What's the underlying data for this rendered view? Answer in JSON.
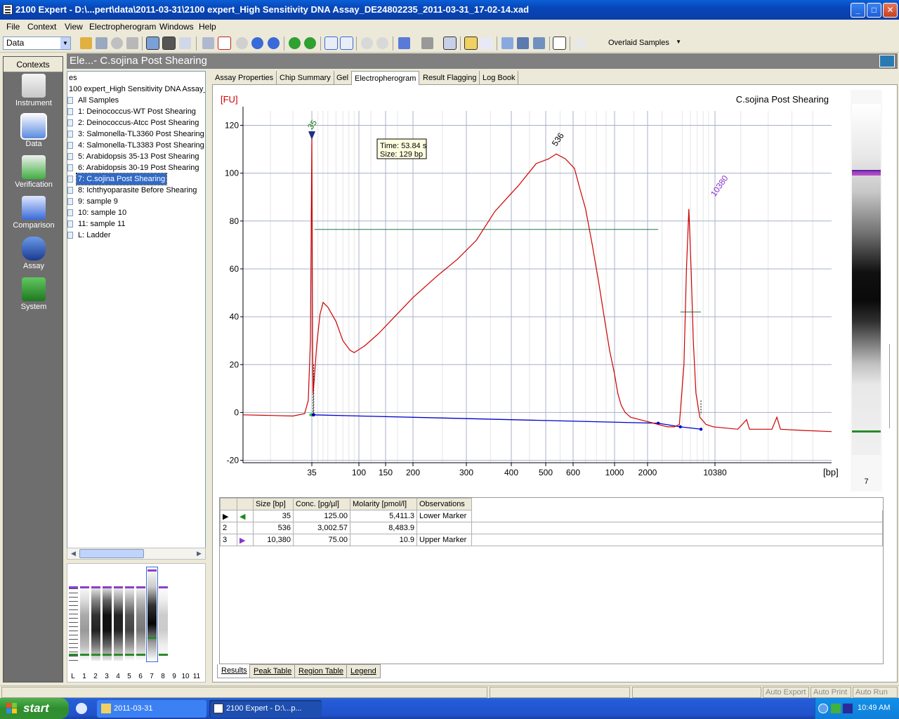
{
  "window": {
    "title": "2100 Expert - D:\\...pert\\data\\2011-03-31\\2100 expert_High Sensitivity DNA Assay_DE24802235_2011-03-31_17-02-14.xad",
    "min": "_",
    "max": "□",
    "close": "✕"
  },
  "menu": [
    "File",
    "Context",
    "View",
    "Electropherogram",
    "Windows",
    "Help"
  ],
  "toolbar": {
    "context_value": "Data",
    "overlay_value": "Overlaid Samples"
  },
  "contexts": {
    "header": "Contexts",
    "items": [
      {
        "label": "Instrument",
        "icon": "instrument-icon"
      },
      {
        "label": "Data",
        "icon": "data-icon"
      },
      {
        "label": "Verification",
        "icon": "verification-icon"
      },
      {
        "label": "Comparison",
        "icon": "comparison-icon"
      },
      {
        "label": "Assay",
        "icon": "assay-icon"
      },
      {
        "label": "System",
        "icon": "system-icon"
      }
    ]
  },
  "tree": {
    "partial": "es",
    "root": "100 expert_High Sensitivity DNA Assay_",
    "items": [
      "All Samples",
      "1: Deinococcus-WT Post Shearing",
      "2: Deinococcus-Atcc Post Shearing",
      "3: Salmonella-TL3360 Post Shearing",
      "4: Salmonella-TL3383 Post Shearing",
      "5: Arabidopsis 35-13 Post Shearing",
      "6: Arabidopsis 30-19 Post Shearing",
      "7: C.sojina Post Shearing",
      "8: Ichthyoparasite Before Shearing",
      "9: sample 9",
      "10: sample 10",
      "11: sample 11",
      "L: Ladder"
    ],
    "selected_index": 7
  },
  "gel_thumbs": {
    "lanes": [
      "L",
      "1",
      "2",
      "3",
      "4",
      "5",
      "6",
      "7",
      "8",
      "9",
      "10",
      "11"
    ],
    "selected": "7"
  },
  "main": {
    "title": "Ele...- C.sojina Post Shearing",
    "tabs": [
      "Assay Properties",
      "Chip Summary",
      "Gel",
      "Electropherogram",
      "Result Flagging",
      "Log Book"
    ]
  },
  "chart_data": {
    "type": "line",
    "title": "C.sojina Post Shearing",
    "ylabel": "[FU]",
    "xlabel": "[bp]",
    "ylim": [
      -20,
      125
    ],
    "yticks": [
      -20,
      0,
      20,
      40,
      60,
      80,
      100,
      120
    ],
    "xtick_labels": [
      "35",
      "100",
      "150",
      "200",
      "300",
      "400",
      "500",
      "600",
      "1000",
      "2000",
      "10380"
    ],
    "grid": true,
    "tooltip": [
      "Time: 53.84 s",
      "Size: 129 bp"
    ],
    "peak_labels": [
      {
        "label": "35",
        "fu": 118,
        "color": "#1a7a1a"
      },
      {
        "label": "536",
        "fu": 111,
        "color": "#000000"
      },
      {
        "label": "10380",
        "fu": 90,
        "color": "#8833cc"
      }
    ],
    "series": [
      {
        "color": "#cc0000",
        "points": [
          [
            20,
            -1
          ],
          [
            24,
            -1.2
          ],
          [
            30,
            -1.5
          ],
          [
            33,
            -0.5
          ],
          [
            34,
            5
          ],
          [
            34.6,
            30
          ],
          [
            35,
            116
          ],
          [
            35.6,
            25
          ],
          [
            36,
            8
          ],
          [
            37,
            14
          ],
          [
            39,
            28
          ],
          [
            42,
            41
          ],
          [
            45,
            46
          ],
          [
            50,
            44
          ],
          [
            60,
            38
          ],
          [
            70,
            30
          ],
          [
            82,
            26
          ],
          [
            90,
            25
          ],
          [
            110,
            28
          ],
          [
            135,
            33
          ],
          [
            165,
            40
          ],
          [
            200,
            48
          ],
          [
            240,
            57
          ],
          [
            280,
            64
          ],
          [
            320,
            72
          ],
          [
            360,
            84
          ],
          [
            420,
            95
          ],
          [
            470,
            104
          ],
          [
            510,
            106
          ],
          [
            536,
            108
          ],
          [
            570,
            106
          ],
          [
            610,
            102
          ],
          [
            650,
            94
          ],
          [
            700,
            85
          ],
          [
            760,
            70
          ],
          [
            820,
            55
          ],
          [
            880,
            40
          ],
          [
            940,
            26
          ],
          [
            1000,
            16
          ],
          [
            1070,
            8
          ],
          [
            1150,
            3
          ],
          [
            1250,
            0
          ],
          [
            1400,
            -2
          ],
          [
            1700,
            -3
          ],
          [
            2100,
            -4
          ],
          [
            2700,
            -5
          ],
          [
            3500,
            -6
          ],
          [
            4200,
            -6
          ],
          [
            4700,
            -5
          ],
          [
            5200,
            20
          ],
          [
            5500,
            60
          ],
          [
            5800,
            85
          ],
          [
            6100,
            60
          ],
          [
            6400,
            30
          ],
          [
            6800,
            8
          ],
          [
            7400,
            -2
          ],
          [
            8500,
            -5
          ],
          [
            10000,
            -6
          ],
          [
            11800,
            -7
          ],
          [
            12400,
            -3
          ],
          [
            12600,
            -7
          ],
          [
            14300,
            -7
          ],
          [
            14700,
            -2
          ],
          [
            15000,
            -7
          ],
          [
            17000,
            -7.5
          ],
          [
            20000,
            -8
          ]
        ]
      }
    ],
    "baseline_color": "#0000cc",
    "region_line_color": "#1a7a4a"
  },
  "peak_table": {
    "headers": [
      "Size [bp]",
      "Conc. [pg/µl]",
      "Molarity [pmol/l]",
      "Observations"
    ],
    "rows": [
      {
        "idx": "",
        "size": "35",
        "conc": "125.00",
        "molarity": "5,411.3",
        "obs": "Lower Marker"
      },
      {
        "idx": "2",
        "size": "536",
        "conc": "3,002.57",
        "molarity": "8,483.9",
        "obs": ""
      },
      {
        "idx": "3",
        "size": "10,380",
        "conc": "75.00",
        "molarity": "10.9",
        "obs": "Upper Marker"
      }
    ]
  },
  "bottom_tabs": [
    "Results",
    "Peak Table",
    "Region Table",
    "Legend"
  ],
  "gel_strip_label": "7",
  "statusbar": [
    "Auto Export",
    "Auto Print",
    "Auto Run"
  ],
  "taskbar": {
    "start": "start",
    "tasks": [
      "2011-03-31",
      "2100 Expert - D:\\...p..."
    ],
    "clock": "10:49 AM"
  }
}
